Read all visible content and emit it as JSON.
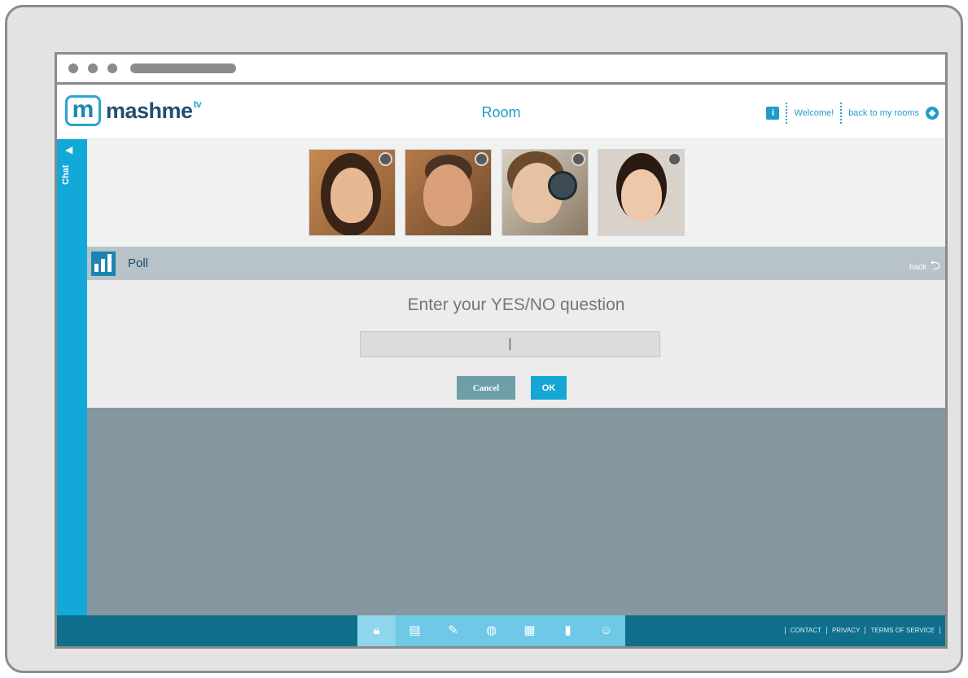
{
  "header": {
    "brand": "mashme",
    "brand_suffix": "tv",
    "room_title": "Room",
    "welcome": "Welcome!",
    "back_to_rooms": "back to my rooms"
  },
  "sidebar": {
    "label": "Chat"
  },
  "participants": [
    {
      "name": "participant-1"
    },
    {
      "name": "participant-2"
    },
    {
      "name": "participant-3"
    },
    {
      "name": "participant-4"
    }
  ],
  "poll": {
    "title": "Poll",
    "back_label": "back",
    "question_label": "Enter your YES/NO question",
    "question_value": "|",
    "cancel_label": "Cancel",
    "ok_label": "OK"
  },
  "toolbar": {
    "tools": [
      "lock-icon",
      "document-icon",
      "edit-icon",
      "globe-icon",
      "gallery-icon",
      "poll-icon",
      "user-add-icon"
    ]
  },
  "footer": {
    "links": [
      "CONTACT",
      "PRIVACY",
      "TERMS OF SERVICE"
    ]
  },
  "colors": {
    "accent": "#12a9d8",
    "footer": "#0f6f8c",
    "stage": "#85989f"
  }
}
